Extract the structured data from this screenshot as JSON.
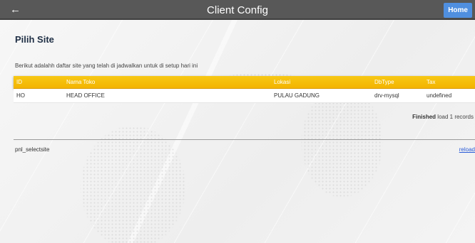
{
  "header": {
    "back_icon": "arrow-left-icon",
    "title": "Client Config",
    "home_label": "Home"
  },
  "main": {
    "heading": "Pilih Site",
    "description": "Berikut adalahh daftar site yang telah di jadwalkan untuk di setup hari ini",
    "table": {
      "columns": [
        "ID",
        "Nama Toko",
        "Lokasi",
        "DbType",
        "Tax"
      ],
      "rows": [
        [
          "HO",
          "HEAD OFFICE",
          "PULAU GADUNG",
          "drv-mysql",
          "undefined"
        ]
      ]
    },
    "status": {
      "bold": "Finished",
      "text": "load 1 records"
    }
  },
  "panel": {
    "name": "pnl_selectsite",
    "reload_label": "reload"
  },
  "colors": {
    "topbar": "#585858",
    "home_button": "#4f8fe0",
    "table_header": "#f3b400",
    "heading": "#1f2f45"
  }
}
